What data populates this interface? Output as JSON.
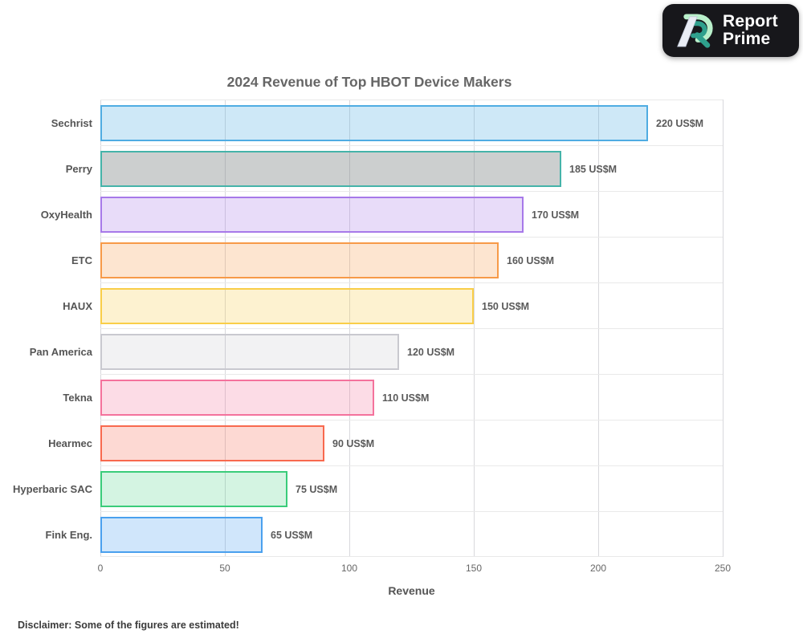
{
  "logo": {
    "line1": "Report",
    "line2": "Prime",
    "bg_color": "#17171b",
    "text_color": "#ffffff",
    "icon_colors": {
      "mint": "#b9f0cb",
      "teal": "#2fa08d",
      "stem": "#e9edf5"
    }
  },
  "chart_data": {
    "type": "bar",
    "orientation": "horizontal",
    "title": "2024 Revenue of Top HBOT Device Makers",
    "xlabel": "Revenue",
    "ylabel": "",
    "categories": [
      "Sechrist",
      "Perry",
      "OxyHealth",
      "ETC",
      "HAUX",
      "Pan America",
      "Tekna",
      "Hearmec",
      "Hyperbaric SAC",
      "Fink Eng."
    ],
    "values": [
      220,
      185,
      170,
      160,
      150,
      120,
      110,
      90,
      75,
      65
    ],
    "value_labels": [
      "220 US$M",
      "185 US$M",
      "170 US$M",
      "160 US$M",
      "150 US$M",
      "120 US$M",
      "110 US$M",
      "90 US$M",
      "75 US$M",
      "65 US$M"
    ],
    "bar_styles": [
      {
        "border": "#4FACE2",
        "fill": "rgba(79,172,226,0.28)"
      },
      {
        "border": "#45B3A9",
        "fill": "rgba(128,134,136,0.40)"
      },
      {
        "border": "#A779E9",
        "fill": "rgba(167,121,233,0.26)"
      },
      {
        "border": "#F79A48",
        "fill": "rgba(247,154,72,0.26)"
      },
      {
        "border": "#F9CE48",
        "fill": "rgba(249,206,72,0.26)"
      },
      {
        "border": "#C9C9CF",
        "fill": "rgba(150,150,155,0.12)"
      },
      {
        "border": "#F4729C",
        "fill": "rgba(244,114,156,0.25)"
      },
      {
        "border": "#F8694E",
        "fill": "rgba(248,105,78,0.25)"
      },
      {
        "border": "#3ACC7A",
        "fill": "rgba(58,204,122,0.22)"
      },
      {
        "border": "#4AA0EE",
        "fill": "rgba(74,160,238,0.26)"
      }
    ],
    "xlim": [
      0,
      250
    ],
    "xticks": [
      0,
      50,
      100,
      150,
      200,
      250
    ],
    "grid": true,
    "legend": false
  },
  "disclaimer": "Disclaimer: Some of the figures are estimated!"
}
